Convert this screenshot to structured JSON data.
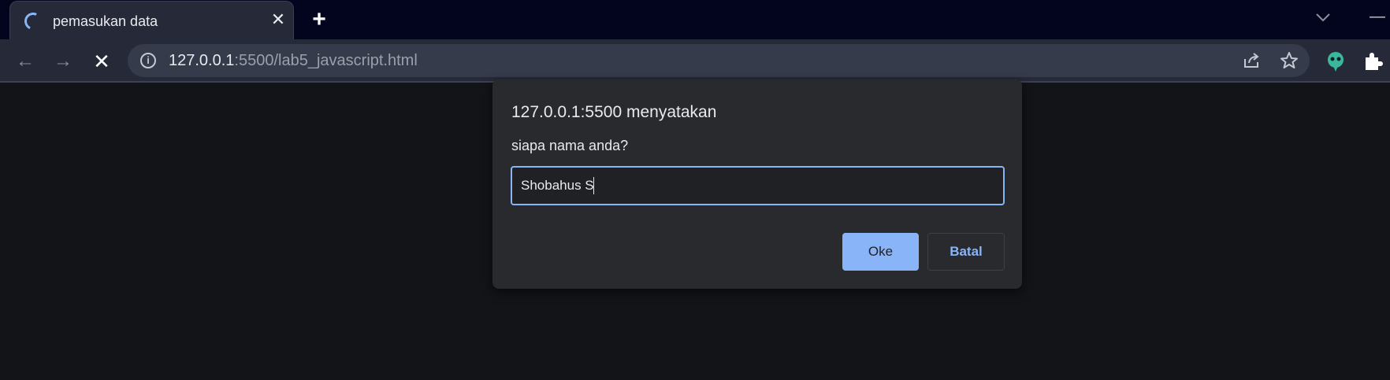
{
  "browser": {
    "tab": {
      "title": "pemasukan data",
      "close_icon": "close-icon",
      "loading": true
    },
    "new_tab_icon": "plus-icon",
    "address_bar": {
      "host": "127.0.0.1",
      "rest": ":5500/lab5_javascript.html"
    },
    "nav": {
      "back": "←",
      "forward": "→",
      "stop": "✕"
    },
    "colors": {
      "tab_strip": "#03041e",
      "toolbar": "#262a38",
      "accent": "#8ab4f8"
    }
  },
  "dialog": {
    "title": "127.0.0.1:5500 menyatakan",
    "message": "siapa nama anda?",
    "input_value": "Shobahus S",
    "ok_label": "Oke",
    "cancel_label": "Batal"
  }
}
